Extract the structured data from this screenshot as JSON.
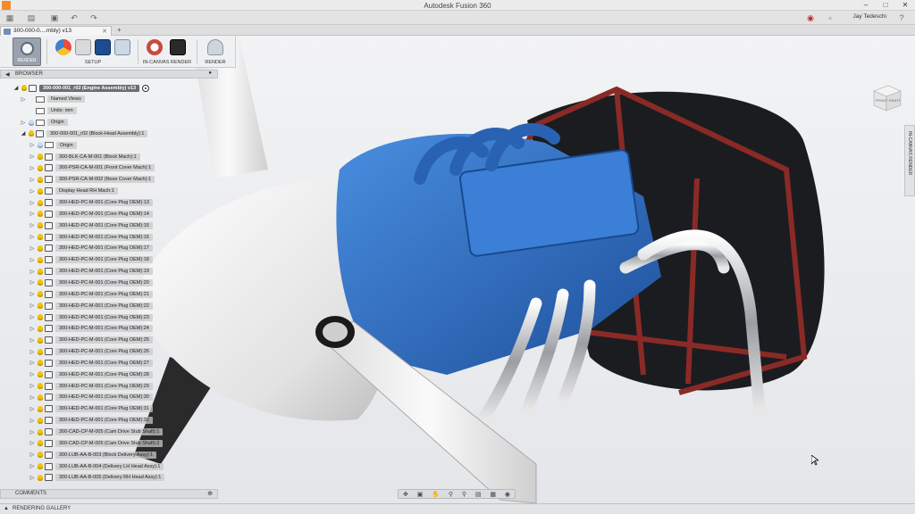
{
  "window": {
    "title": "Autodesk Fusion 360",
    "minimize_icon": "minimize-icon",
    "maximize_icon": "maximize-icon",
    "close_icon": "close-icon"
  },
  "quickbar": {
    "user_name": "Jay Tedeschi",
    "help_label": "?"
  },
  "tabs": {
    "doc_tab_label": "300-000-0....mbly) v13"
  },
  "toolbar": {
    "workspace_label": "RENDER",
    "setup_label": "SETUP",
    "incanvas_label": "IN-CANVAS RENDER",
    "render_label": "RENDER"
  },
  "browser": {
    "header": "BROWSER",
    "items": [
      {
        "label": "300-000-001_r02 (Engine Assembly) v13",
        "level": 0,
        "kind": "root"
      },
      {
        "label": "Named Views",
        "level": 1,
        "kind": "folder"
      },
      {
        "label": "Units: mm",
        "level": 1,
        "kind": "units"
      },
      {
        "label": "Origin",
        "level": 1,
        "kind": "folder-bulb"
      },
      {
        "label": "300-000-001_r02 (Block-Head Assembly):1",
        "level": 1,
        "kind": "component"
      },
      {
        "label": "Origin",
        "level": 2,
        "kind": "folder-bulb"
      },
      {
        "label": "300-BLK-CA-M-001 (Block Mach):1",
        "level": 2,
        "kind": "component"
      },
      {
        "label": "300-PSR-CA-M-001 (Front Cover Mach):1",
        "level": 2,
        "kind": "component"
      },
      {
        "label": "300-PSR-CA-M-002 (Nose Cover Mach):1",
        "level": 2,
        "kind": "component"
      },
      {
        "label": "Display Head RH Mach:1",
        "level": 2,
        "kind": "component"
      },
      {
        "label": "300-HED-PC-M-001 (Core Plug OEM):13",
        "level": 2,
        "kind": "component"
      },
      {
        "label": "300-HED-PC-M-001 (Core Plug OEM):14",
        "level": 2,
        "kind": "component"
      },
      {
        "label": "300-HED-PC-M-001 (Core Plug OEM):15",
        "level": 2,
        "kind": "component"
      },
      {
        "label": "300-HED-PC-M-001 (Core Plug OEM):16",
        "level": 2,
        "kind": "component"
      },
      {
        "label": "300-HED-PC-M-001 (Core Plug OEM):17",
        "level": 2,
        "kind": "component"
      },
      {
        "label": "300-HED-PC-M-001 (Core Plug OEM):18",
        "level": 2,
        "kind": "component"
      },
      {
        "label": "300-HED-PC-M-001 (Core Plug OEM):19",
        "level": 2,
        "kind": "component"
      },
      {
        "label": "300-HED-PC-M-001 (Core Plug OEM):20",
        "level": 2,
        "kind": "component"
      },
      {
        "label": "300-HED-PC-M-001 (Core Plug OEM):21",
        "level": 2,
        "kind": "component"
      },
      {
        "label": "300-HED-PC-M-001 (Core Plug OEM):22",
        "level": 2,
        "kind": "component"
      },
      {
        "label": "300-HED-PC-M-001 (Core Plug OEM):23",
        "level": 2,
        "kind": "component"
      },
      {
        "label": "300-HED-PC-M-001 (Core Plug OEM):24",
        "level": 2,
        "kind": "component"
      },
      {
        "label": "300-HED-PC-M-001 (Core Plug OEM):25",
        "level": 2,
        "kind": "component"
      },
      {
        "label": "300-HED-PC-M-001 (Core Plug OEM):26",
        "level": 2,
        "kind": "component"
      },
      {
        "label": "300-HED-PC-M-001 (Core Plug OEM):27",
        "level": 2,
        "kind": "component"
      },
      {
        "label": "300-HED-PC-M-001 (Core Plug OEM):28",
        "level": 2,
        "kind": "component"
      },
      {
        "label": "300-HED-PC-M-001 (Core Plug OEM):29",
        "level": 2,
        "kind": "component"
      },
      {
        "label": "300-HED-PC-M-001 (Core Plug OEM):30",
        "level": 2,
        "kind": "component"
      },
      {
        "label": "300-HED-PC-M-001 (Core Plug OEM):31",
        "level": 2,
        "kind": "component"
      },
      {
        "label": "300-HED-PC-M-001 (Core Plug OEM):32",
        "level": 2,
        "kind": "component"
      },
      {
        "label": "300-CAD-CP-M-005 (Cam Drive Stub Shaft):1",
        "level": 2,
        "kind": "component"
      },
      {
        "label": "300-CAD-CP-M-005 (Cam Drive Stub Shaft):2",
        "level": 2,
        "kind": "component"
      },
      {
        "label": "300-LUB-AA-B-003 (Block Delivery Assy):1",
        "level": 2,
        "kind": "assembly"
      },
      {
        "label": "300-LUB-AA-B-004 (Delivery LH Head Assy):1",
        "level": 2,
        "kind": "assembly"
      },
      {
        "label": "300-LUB-AA-B-005 (Delivery RH Head Assy):1",
        "level": 2,
        "kind": "assembly"
      }
    ]
  },
  "comments": {
    "label": "COMMENTS"
  },
  "gallery": {
    "label": "RENDERING GALLERY"
  },
  "side_panel": {
    "label": "IN-CANVAS RENDER"
  },
  "viewcube": {
    "front_label": "FRONT",
    "right_label": "RIGHT"
  },
  "colors": {
    "engine_blue": "#2f6fc7",
    "frame_red": "#8a2a26",
    "propeller_white": "#eeeeee"
  }
}
